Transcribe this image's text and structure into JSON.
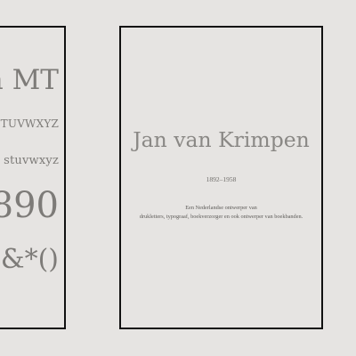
{
  "left_card": {
    "name_fragment": "n MT",
    "uppercase_fragment": "STUVWXYZ",
    "lowercase_fragment": "stuvwxyz",
    "digits_fragment": "890",
    "symbols_fragment": "^&*()"
  },
  "right_card": {
    "title": "Jan van Krimpen",
    "years": "1892–1958",
    "description_line_1": "Een Nederlandse ontwerper van",
    "description_line_2": "drukletters, typograaf, boekverzorger en ook ontwerper van boekbanden."
  },
  "colors": {
    "background": "#e6e4e2",
    "border": "#111111",
    "title_text": "#8a8885"
  }
}
